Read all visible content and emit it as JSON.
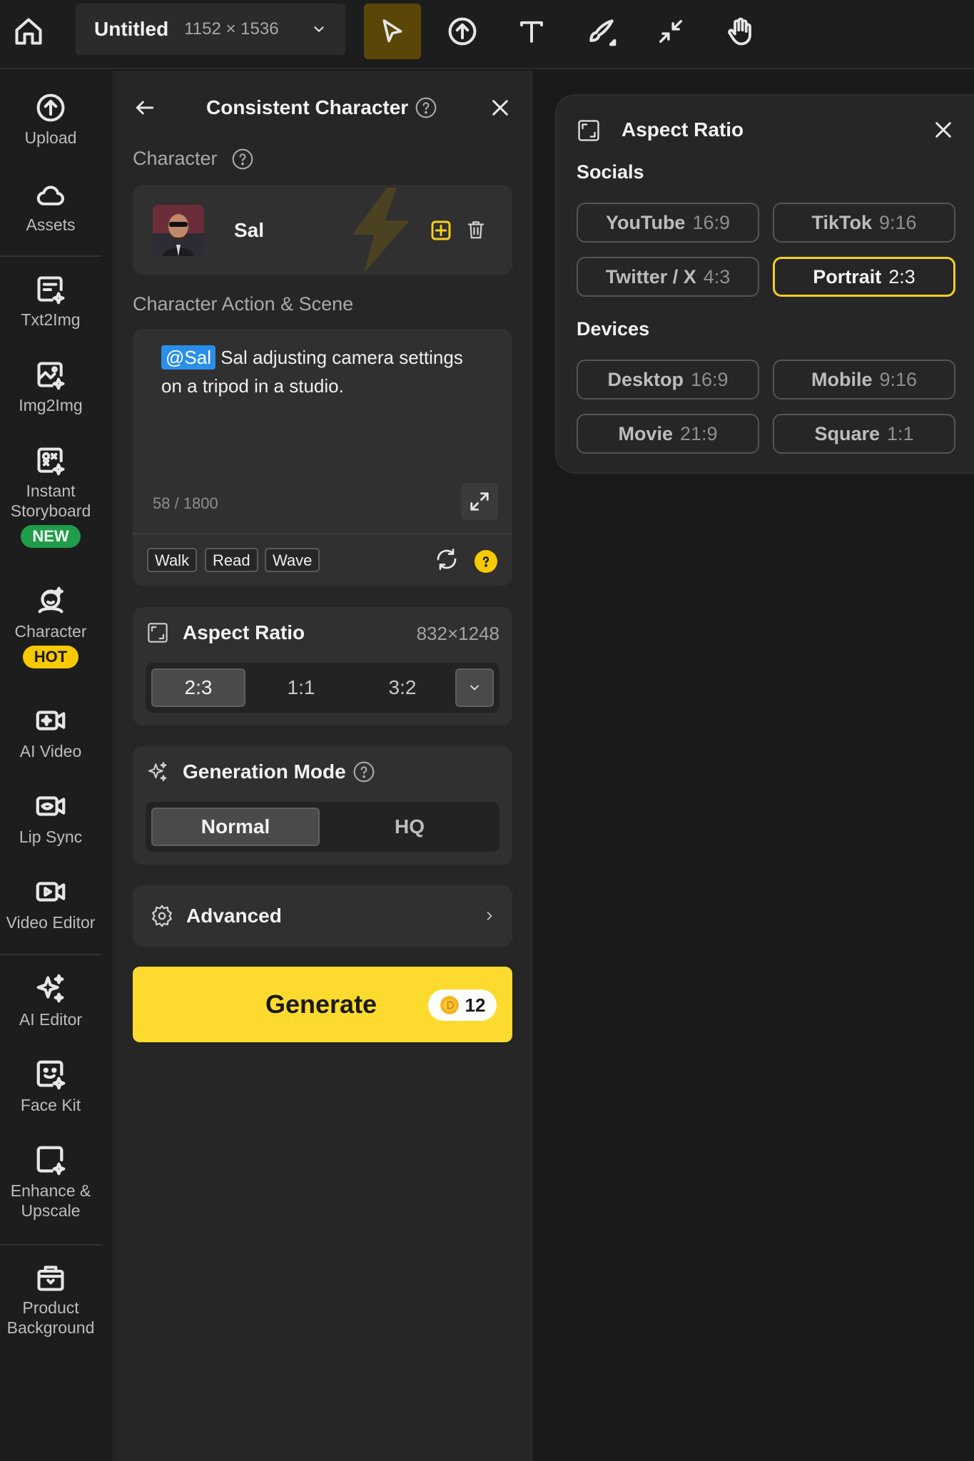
{
  "toolbar": {
    "doc_title": "Untitled",
    "doc_size": "1152 × 1536",
    "tools": [
      "home-icon",
      "select-icon",
      "upload-icon",
      "text-icon",
      "brush-icon",
      "collapse-icon",
      "hand-icon"
    ]
  },
  "sidebar": {
    "items": [
      {
        "label": "Upload",
        "icon": "upload-icon"
      },
      {
        "label": "Assets",
        "icon": "cloud-icon"
      },
      {
        "label": "Txt2Img",
        "icon": "text-to-image-icon"
      },
      {
        "label": "Img2Img",
        "icon": "image-to-image-icon"
      },
      {
        "label": "Instant Storyboard",
        "icon": "storyboard-icon",
        "badge": "NEW"
      },
      {
        "label": "Character",
        "icon": "character-icon",
        "badge": "HOT"
      },
      {
        "label": "AI Video",
        "icon": "ai-video-icon"
      },
      {
        "label": "Lip Sync",
        "icon": "lip-sync-icon"
      },
      {
        "label": "Video Editor",
        "icon": "video-editor-icon"
      },
      {
        "label": "AI Editor",
        "icon": "sparkle-icon"
      },
      {
        "label": "Face Kit",
        "icon": "face-kit-icon"
      },
      {
        "label": "Enhance & Upscale",
        "icon": "enhance-icon"
      },
      {
        "label": "Product Background",
        "icon": "product-icon"
      }
    ]
  },
  "panel": {
    "title": "Consistent Character",
    "character_label": "Character",
    "character_name": "Sal",
    "scene_label": "Character Action & Scene",
    "prompt_mention": "@Sal",
    "prompt_text": " Sal adjusting camera settings on a tripod in a studio.",
    "counter": "58 / 1800",
    "chips": [
      "Walk",
      "Read",
      "Wave"
    ],
    "aspect": {
      "title": "Aspect Ratio",
      "resolution": "832×1248",
      "options": [
        "2:3",
        "1:1",
        "3:2"
      ],
      "selected": "2:3"
    },
    "mode": {
      "title": "Generation Mode",
      "options": [
        "Normal",
        "HQ"
      ],
      "selected": "Normal"
    },
    "advanced_label": "Advanced",
    "generate_label": "Generate",
    "generate_cost": "12"
  },
  "popover": {
    "title": "Aspect Ratio",
    "socials_label": "Socials",
    "socials": [
      {
        "name": "YouTube",
        "ratio": "16:9"
      },
      {
        "name": "TikTok",
        "ratio": "9:16"
      },
      {
        "name": "Twitter / X",
        "ratio": "4:3"
      },
      {
        "name": "Portrait",
        "ratio": "2:3"
      }
    ],
    "devices_label": "Devices",
    "devices": [
      {
        "name": "Desktop",
        "ratio": "16:9"
      },
      {
        "name": "Mobile",
        "ratio": "9:16"
      },
      {
        "name": "Movie",
        "ratio": "21:9"
      },
      {
        "name": "Square",
        "ratio": "1:1"
      }
    ],
    "selected": "Portrait",
    "accent_color": "#f3cf24"
  }
}
